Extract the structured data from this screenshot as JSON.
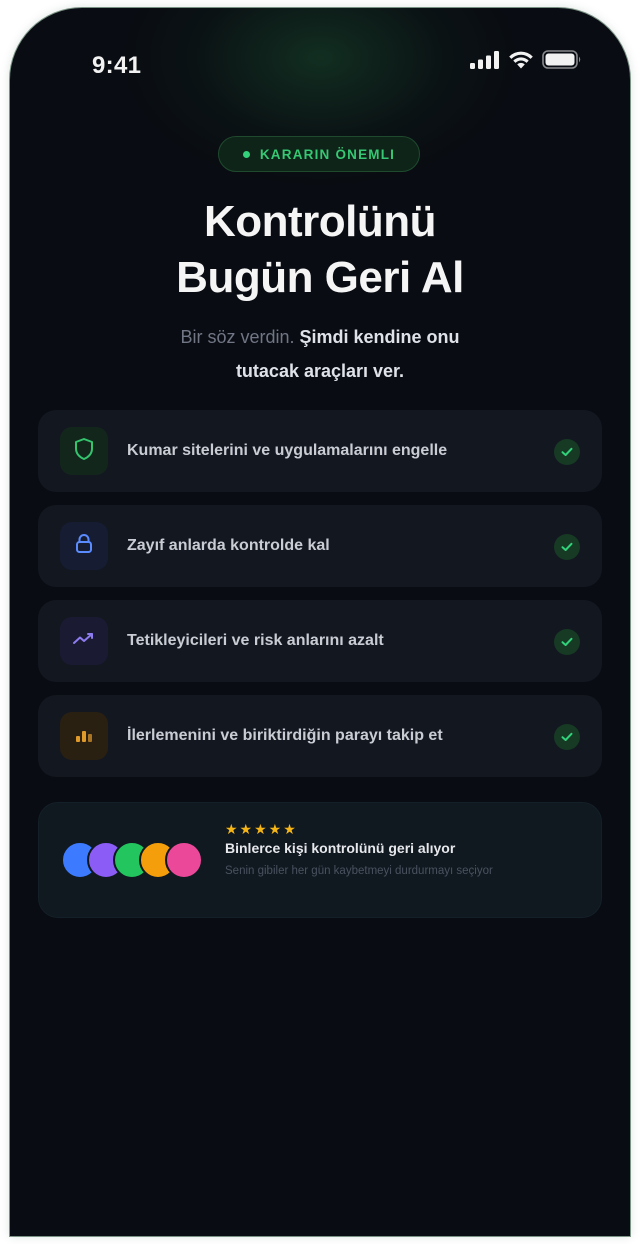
{
  "status_bar": {
    "time": "9:41",
    "icons": [
      "cellular-signal-icon",
      "wifi-icon",
      "battery-icon"
    ]
  },
  "badge": {
    "label": "KARARIN ÖNEMLI",
    "accent": "#33d17a"
  },
  "headline": {
    "line1": "Kontrolünü",
    "line2": "Bugün Geri Al"
  },
  "subtitle": {
    "muted": "Bir söz verdin.",
    "strong_1": "Şimdi kendine onu",
    "strong_2": "tutacak araçları ver."
  },
  "features": [
    {
      "label": "Kumar sitelerini ve uygulamalarını engelle",
      "icon": "shield-icon",
      "color": "#35c46e",
      "checked": true
    },
    {
      "label": "Zayıf anlarda kontrolde kal",
      "icon": "lock-icon",
      "color": "#5b8cff",
      "checked": true
    },
    {
      "label": "Tetikleyicileri ve risk anlarını azalt",
      "icon": "trend-line-icon",
      "color": "#8d7cf0",
      "checked": true
    },
    {
      "label": "İlerlemenini ve biriktirdiğin parayı takip et",
      "icon": "bar-chart-icon",
      "color": "#e09a2a",
      "checked": true
    }
  ],
  "social_proof": {
    "rating_stars": 5,
    "stars_text": "★★★★★",
    "title": "Binlerce kişi kontrolünü geri alıyor",
    "description": "Senin gibiler her gün kaybetmeyi durdurmayı seçiyor",
    "avatar_colors": [
      "#3c7bff",
      "#8b5cf6",
      "#22c55e",
      "#f59e0b",
      "#ec4899"
    ]
  },
  "colors": {
    "background": "#090c12",
    "card": "#131720",
    "accent": "#33d17a"
  }
}
